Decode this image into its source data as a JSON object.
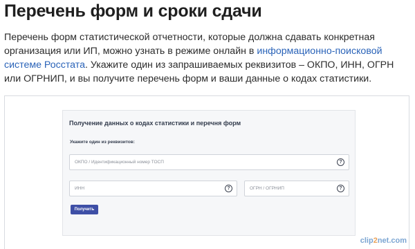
{
  "heading": "Перечень форм и сроки сдачи",
  "intro": {
    "text_before": "Перечень форм статистической отчетности, которые должна сдавать конкретная организация или ИП, можно узнать в режиме онлайн в ",
    "link_text": "информационно-поисковой системе Росстата",
    "text_after": ". Укажите один из запрашиваемых реквизитов – ОКПО, ИНН, ОГРН или ОГРНИП, и вы получите перечень форм и ваши данные о кодах статистики."
  },
  "form": {
    "title": "Получение данных о кодах статистики и перечня форм",
    "label": "Укажите один из реквизитов:",
    "okpo_placeholder": "ОКПО / Идентификационный номер ТОСП",
    "inn_placeholder": "ИНН",
    "ogrn_placeholder": "ОГРН / ОГРНИП",
    "help_glyph": "?",
    "submit_label": "Получить"
  },
  "watermark": {
    "part1": "clip",
    "part2": "2",
    "part3": "net.com"
  }
}
